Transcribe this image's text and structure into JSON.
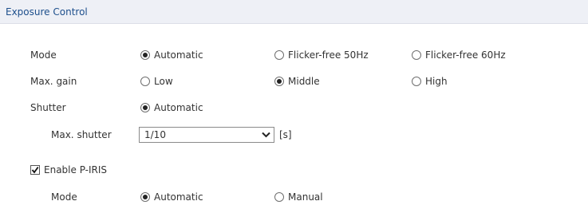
{
  "header": {
    "title": "Exposure Control"
  },
  "mode": {
    "label": "Mode",
    "options": [
      {
        "label": "Automatic",
        "selected": true
      },
      {
        "label": "Flicker-free 50Hz",
        "selected": false
      },
      {
        "label": "Flicker-free 60Hz",
        "selected": false
      }
    ]
  },
  "max_gain": {
    "label": "Max. gain",
    "options": [
      {
        "label": "Low",
        "selected": false
      },
      {
        "label": "Middle",
        "selected": true
      },
      {
        "label": "High",
        "selected": false
      }
    ]
  },
  "shutter": {
    "label": "Shutter",
    "option": {
      "label": "Automatic",
      "selected": true
    },
    "max_shutter": {
      "label": "Max. shutter",
      "value": "1/10",
      "unit": "[s]"
    }
  },
  "piris": {
    "enable_label": "Enable P-IRIS",
    "enabled": true,
    "mode_label": "Mode",
    "options": [
      {
        "label": "Automatic",
        "selected": true
      },
      {
        "label": "Manual",
        "selected": false
      }
    ]
  }
}
